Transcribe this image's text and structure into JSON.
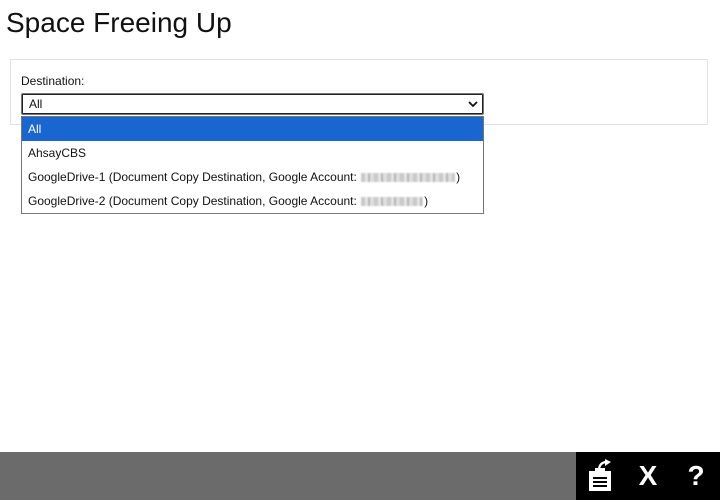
{
  "page": {
    "title": "Space Freeing Up"
  },
  "destination": {
    "label": "Destination:",
    "selected_value": "All",
    "options": [
      {
        "label": "All",
        "selected": true
      },
      {
        "label": "AhsayCBS"
      },
      {
        "label_prefix": "GoogleDrive-1 (Document Copy Destination, Google Account: ",
        "label_suffix": ")",
        "redacted": true
      },
      {
        "label_prefix": "GoogleDrive-2 (Document Copy Destination, Google Account: ",
        "label_suffix": ")",
        "redacted": true
      }
    ]
  },
  "footer": {
    "actions": [
      {
        "name": "apply-icon"
      },
      {
        "name": "close-icon",
        "label": "X"
      },
      {
        "name": "help-icon",
        "label": "?"
      }
    ]
  },
  "colors": {
    "selection": "#1a66d1",
    "footer_bar": "#6b6b6b",
    "footer_actions": "#000000"
  }
}
